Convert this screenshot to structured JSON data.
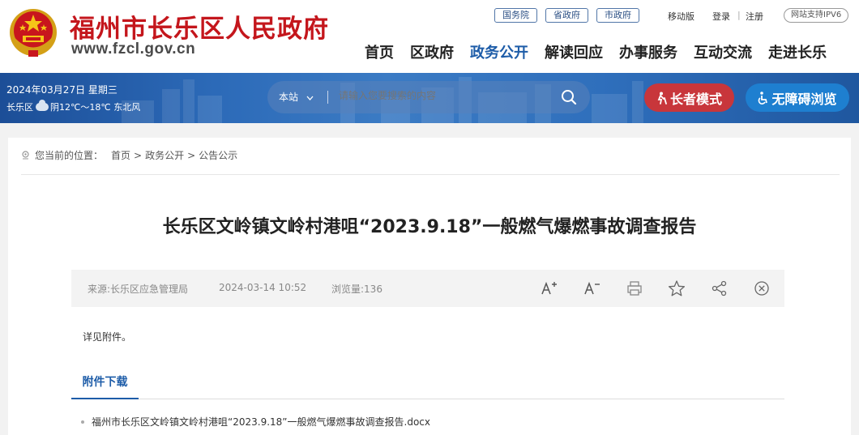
{
  "header": {
    "site_title": "福州市长乐区人民政府",
    "site_domain": "www.fzcl.gov.cn",
    "top_links": [
      "国务院",
      "省政府",
      "市政府"
    ],
    "utilities": [
      "移动版",
      "登录",
      "注册"
    ],
    "ipv6_badge": "网站支持IPV6",
    "nav": [
      "首页",
      "区政府",
      "政务公开",
      "解读回应",
      "办事服务",
      "互动交流",
      "走进长乐"
    ],
    "nav_active": "政务公开"
  },
  "banner": {
    "date": "2024年03月27日 星期三",
    "location": "长乐区",
    "weather": "阴12℃～18℃ 东北风",
    "search": {
      "scope": "本站",
      "placeholder": "请输入您要搜索的内容"
    },
    "elder_mode_label": "长者模式",
    "accessibility_label": "无障碍浏览"
  },
  "breadcrumb": {
    "prefix": "您当前的位置：",
    "items": [
      "首页",
      "政务公开",
      "公告公示"
    ],
    "separator": ">"
  },
  "article": {
    "title": "长乐区文岭镇文岭村港咀“2023.9.18”一般燃气爆燃事故调查报告",
    "source": "来源:长乐区应急管理局",
    "datetime": "2024-03-14 10:52",
    "views": "浏览量:136",
    "body": "详见附件。"
  },
  "attachments": {
    "heading": "附件下载",
    "files": [
      "福州市长乐区文岭镇文岭村港咀“2023.9.18”一般燃气爆燃事故调查报告.docx"
    ]
  },
  "colors": {
    "brand_red": "#c4161c",
    "nav_blue": "#1d5ca8",
    "elder_button": "#c8363b",
    "access_button": "#1e7fd0"
  },
  "icons": [
    "national-emblem-icon",
    "cloud-icon",
    "chevron-down-icon",
    "search-icon",
    "elder-icon",
    "wheelchair-icon",
    "location-pin-icon",
    "font-increase-icon",
    "font-decrease-icon",
    "print-icon",
    "star-icon",
    "share-icon",
    "close-icon"
  ]
}
